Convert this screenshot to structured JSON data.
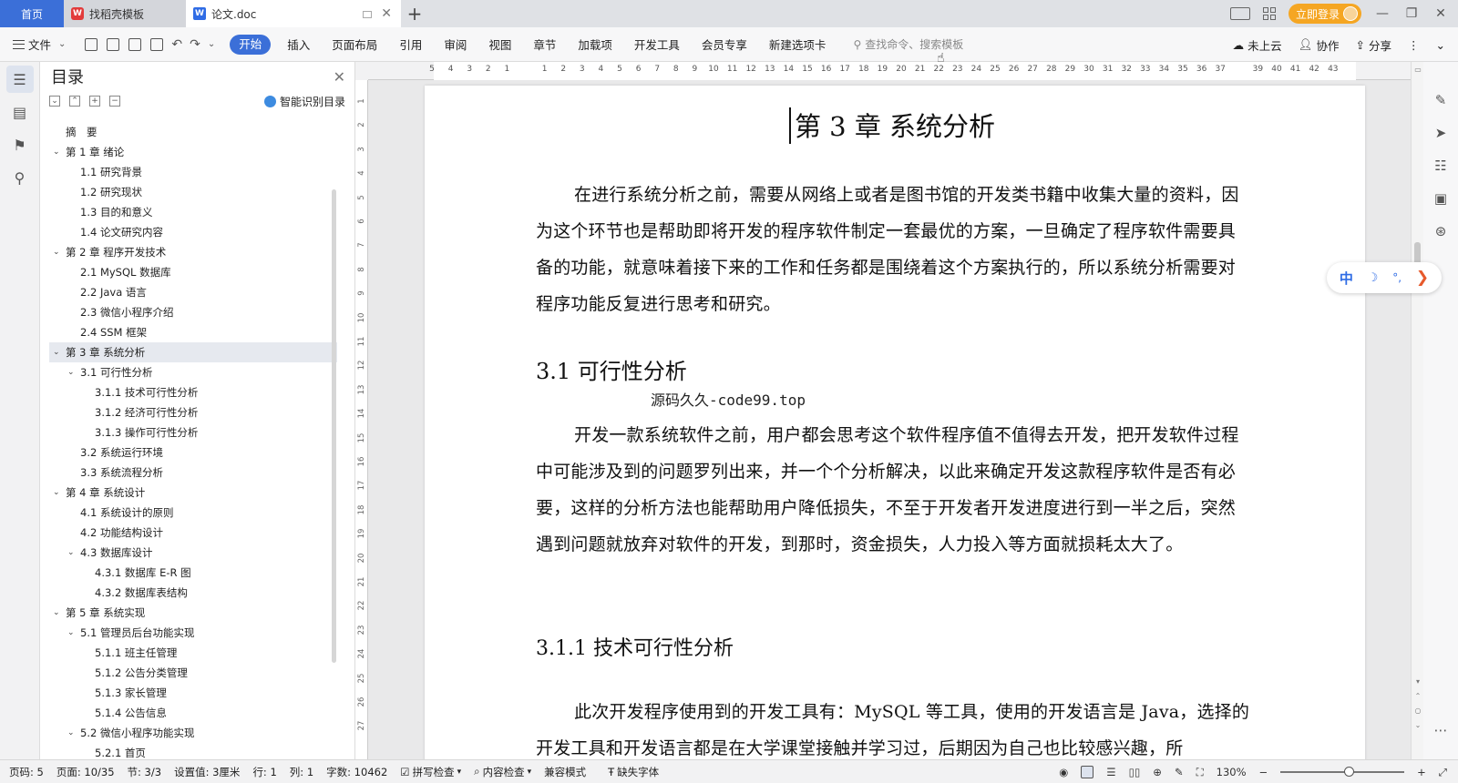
{
  "titlebar": {
    "tabs": [
      {
        "label": "首页"
      },
      {
        "label": "找稻壳模板"
      },
      {
        "label": "论文.doc"
      }
    ],
    "login_label": "立即登录"
  },
  "ribbon": {
    "file_label": "文件",
    "tabs": [
      "开始",
      "插入",
      "页面布局",
      "引用",
      "审阅",
      "视图",
      "章节",
      "加载项",
      "开发工具",
      "会员专享",
      "新建选项卡"
    ],
    "search_placeholder": "查找命令、搜索模板",
    "cloud_label": "未上云",
    "collab_label": "协作",
    "share_label": "分享"
  },
  "toc": {
    "title": "目录",
    "smart_label": "智能识别目录",
    "items": [
      {
        "label": "摘　要",
        "level": 0,
        "arrow": false,
        "selected": false
      },
      {
        "label": "第 1 章  绪论",
        "level": 0,
        "arrow": true,
        "selected": false
      },
      {
        "label": "1.1  研究背景",
        "level": 1,
        "arrow": false,
        "selected": false
      },
      {
        "label": "1.2  研究现状",
        "level": 1,
        "arrow": false,
        "selected": false
      },
      {
        "label": "1.3  目的和意义",
        "level": 1,
        "arrow": false,
        "selected": false
      },
      {
        "label": "1.4  论文研究内容",
        "level": 1,
        "arrow": false,
        "selected": false
      },
      {
        "label": "第 2 章  程序开发技术",
        "level": 0,
        "arrow": true,
        "selected": false
      },
      {
        "label": "2.1 MySQL 数据库",
        "level": 1,
        "arrow": false,
        "selected": false
      },
      {
        "label": "2.2 Java 语言",
        "level": 1,
        "arrow": false,
        "selected": false
      },
      {
        "label": "2.3  微信小程序介绍",
        "level": 1,
        "arrow": false,
        "selected": false
      },
      {
        "label": "2.4 SSM 框架",
        "level": 1,
        "arrow": false,
        "selected": false
      },
      {
        "label": "第 3 章  系统分析",
        "level": 0,
        "arrow": true,
        "selected": true
      },
      {
        "label": "3.1 可行性分析",
        "level": 1,
        "arrow": true,
        "selected": false
      },
      {
        "label": "3.1.1 技术可行性分析",
        "level": 2,
        "arrow": false,
        "selected": false
      },
      {
        "label": "3.1.2 经济可行性分析",
        "level": 2,
        "arrow": false,
        "selected": false
      },
      {
        "label": "3.1.3 操作可行性分析",
        "level": 2,
        "arrow": false,
        "selected": false
      },
      {
        "label": "3.2 系统运行环境",
        "level": 1,
        "arrow": false,
        "selected": false
      },
      {
        "label": "3.3 系统流程分析",
        "level": 1,
        "arrow": false,
        "selected": false
      },
      {
        "label": "第 4 章  系统设计",
        "level": 0,
        "arrow": true,
        "selected": false
      },
      {
        "label": "4.1  系统设计的原则",
        "level": 1,
        "arrow": false,
        "selected": false
      },
      {
        "label": "4.2  功能结构设计",
        "level": 1,
        "arrow": false,
        "selected": false
      },
      {
        "label": "4.3  数据库设计",
        "level": 1,
        "arrow": true,
        "selected": false
      },
      {
        "label": "4.3.1  数据库 E-R 图",
        "level": 2,
        "arrow": false,
        "selected": false
      },
      {
        "label": "4.3.2  数据库表结构",
        "level": 2,
        "arrow": false,
        "selected": false
      },
      {
        "label": "第 5 章  系统实现",
        "level": 0,
        "arrow": true,
        "selected": false
      },
      {
        "label": "5.1 管理员后台功能实现",
        "level": 1,
        "arrow": true,
        "selected": false
      },
      {
        "label": "5.1.1  班主任管理",
        "level": 2,
        "arrow": false,
        "selected": false
      },
      {
        "label": "5.1.2  公告分类管理",
        "level": 2,
        "arrow": false,
        "selected": false
      },
      {
        "label": "5.1.3  家长管理",
        "level": 2,
        "arrow": false,
        "selected": false
      },
      {
        "label": "5.1.4  公告信息",
        "level": 2,
        "arrow": false,
        "selected": false
      },
      {
        "label": "5.2  微信小程序功能实现",
        "level": 1,
        "arrow": true,
        "selected": false
      },
      {
        "label": "5.2.1  首页",
        "level": 2,
        "arrow": false,
        "selected": false
      }
    ]
  },
  "ruler": {
    "h_numbers": [
      "5",
      "4",
      "3",
      "2",
      "1",
      "",
      "1",
      "2",
      "3",
      "4",
      "5",
      "6",
      "7",
      "8",
      "9",
      "10",
      "11",
      "12",
      "13",
      "14",
      "15",
      "16",
      "17",
      "18",
      "19",
      "20",
      "21",
      "22",
      "23",
      "24",
      "25",
      "26",
      "27",
      "28",
      "29",
      "30",
      "31",
      "32",
      "33",
      "34",
      "35",
      "36",
      "37",
      "",
      "39",
      "40",
      "41",
      "42",
      "43"
    ],
    "v_numbers": [
      "1",
      "2",
      "3",
      "4",
      "5",
      "6",
      "7",
      "8",
      "9",
      "10",
      "11",
      "12",
      "13",
      "14",
      "15",
      "16",
      "17",
      "18",
      "19",
      "20",
      "21",
      "22",
      "23",
      "24",
      "25",
      "26",
      "27"
    ]
  },
  "document": {
    "chapter_title": "第 3 章  系统分析",
    "para1": "在进行系统分析之前，需要从网络上或者是图书馆的开发类书籍中收集大量的资料，因为这个环节也是帮助即将开发的程序软件制定一套最优的方案，一旦确定了程序软件需要具备的功能，就意味着接下来的工作和任务都是围绕着这个方案执行的，所以系统分析需要对程序功能反复进行思考和研究。",
    "section_title": "3.1 可行性分析",
    "watermark": "源码久久-code99.top",
    "para2": "开发一款系统软件之前，用户都会思考这个软件程序值不值得去开发，把开发软件过程中可能涉及到的问题罗列出来，并一个个分析解决，以此来确定开发这款程序软件是否有必要，这样的分析方法也能帮助用户降低损失，不至于开发者开发进度进行到一半之后，突然遇到问题就放弃对软件的开发，到那时，资金损失，人力投入等方面就损耗太大了。",
    "subsection_title": "3.1.1 技术可行性分析",
    "para3": "此次开发程序使用到的开发工具有：MySQL 等工具，使用的开发语言是 Java，选择的开发工具和开发语言都是在大学课堂接触并学习过，后期因为自己也比较感兴趣，所"
  },
  "floatbar": {
    "zh": "中",
    "moon": "☽",
    "punct": "°,",
    "arrow": "❯"
  },
  "status": {
    "page_code": "页码: 5",
    "page": "页面: 10/35",
    "section": "节: 3/3",
    "setting": "设置值: 3厘米",
    "row": "行: 1",
    "col": "列: 1",
    "words": "字数: 10462",
    "spell": "拼写检查",
    "content_check": "内容检查",
    "compat": "兼容模式",
    "missing_font": "缺失字体",
    "zoom": "130%"
  },
  "colors": {
    "accent": "#3b6fd8",
    "login": "#f5a623"
  }
}
